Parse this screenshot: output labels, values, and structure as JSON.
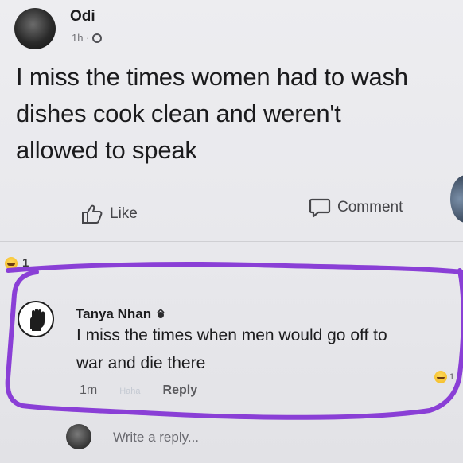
{
  "post": {
    "author": "Odi",
    "time": "1h ·",
    "text_lines": [
      "I miss the times women had to wash",
      "dishes cook clean and weren't",
      "allowed to speak"
    ]
  },
  "actions": {
    "like_label": "Like",
    "comment_label": "Comment"
  },
  "reactions": {
    "count": "1"
  },
  "comment": {
    "author": "Tanya Nhan",
    "text_lines": [
      "I miss the times when men would go off to",
      "war and die there"
    ],
    "time": "1m",
    "haha_label": "Haha",
    "reply_label": "Reply",
    "reaction_count": "1"
  },
  "reply_box": {
    "placeholder": "Write a reply..."
  },
  "colors": {
    "highlight": "#8a3fd6"
  }
}
